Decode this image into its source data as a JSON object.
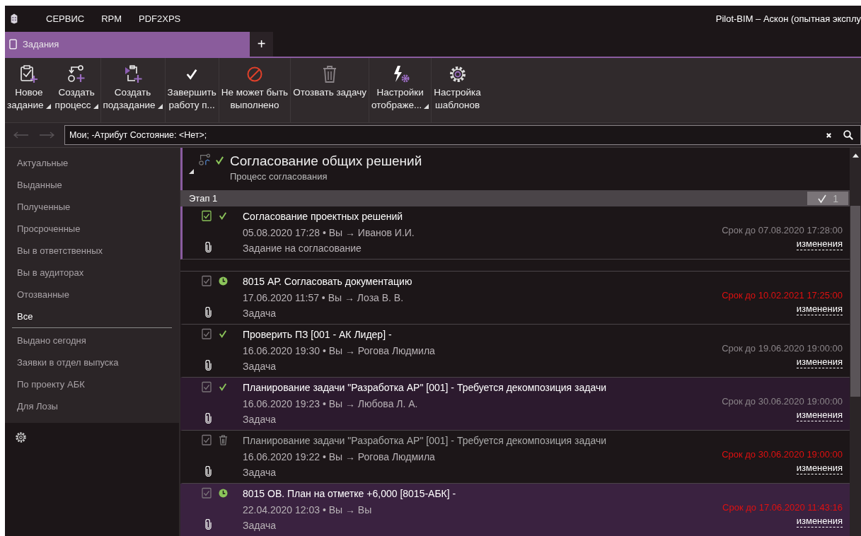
{
  "menu": {
    "items": [
      "СЕРВИС",
      "RPM",
      "PDF2XPS"
    ],
    "title": "Pilot-BIM – Аскон (опытная эксплу"
  },
  "tabs": [
    {
      "label": "Задания",
      "selected": true
    }
  ],
  "new_tab": "+",
  "toolbar": [
    {
      "kind": "taskadd",
      "lines": [
        "Новое",
        "задание"
      ],
      "dropdown": true
    },
    {
      "kind": "processadd",
      "lines": [
        "Создать",
        "процесс"
      ],
      "dropdown": true
    },
    {
      "kind": "subtaskadd",
      "lines": [
        "Создать",
        "подзадание"
      ],
      "dropdown": true
    },
    {
      "kind": "complete",
      "lines": [
        "Завершить",
        "работу п..."
      ],
      "dropdown": false
    },
    {
      "kind": "forbid",
      "lines": [
        "Не может быть",
        "выполнено"
      ],
      "dropdown": false
    },
    {
      "kind": "revoke",
      "lines": [
        "Отозвать задачу"
      ],
      "dropdown": false
    },
    {
      "kind": "display",
      "lines": [
        "Настройки",
        "отображе..."
      ],
      "dropdown": true
    },
    {
      "kind": "templates",
      "lines": [
        "Настройка",
        "шаблонов"
      ],
      "dropdown": false
    }
  ],
  "search": {
    "value": "Мои; -Атрибут Состояние: <Нет>;"
  },
  "sidebar": {
    "groups": [
      [
        {
          "label": "Актуальные",
          "selected": false
        },
        {
          "label": "Выданные",
          "selected": false
        },
        {
          "label": "Полученные",
          "selected": false
        },
        {
          "label": "Просроченные",
          "selected": false
        },
        {
          "label": "Вы в ответственных",
          "selected": false
        },
        {
          "label": "Вы в аудиторах",
          "selected": false
        },
        {
          "label": "Отозванные",
          "selected": false
        },
        {
          "label": "Все",
          "selected": true
        }
      ],
      [
        {
          "label": "Выдано сегодня",
          "selected": false
        },
        {
          "label": "Заявки в отдел выпуска",
          "selected": false
        },
        {
          "label": "По проекту АБК",
          "selected": false
        },
        {
          "label": "Для Лозы",
          "selected": false
        }
      ]
    ]
  },
  "process": {
    "title": "Согласование общих решений",
    "subtitle": "Процесс согласования",
    "expanded": true,
    "done": true,
    "stage": {
      "title": "Этап 1",
      "count": "1"
    },
    "tasks": [
      {
        "title": "Согласование проектных решений",
        "meta": "05.08.2020 17:28 • Вы → Иванов И.И.",
        "kind_label": "Задание на согласование",
        "deadline": "Срок до 07.08.2020 17:28:00",
        "link": "изменения",
        "kind": "done",
        "overdue": false,
        "highlighted": false,
        "selected": true,
        "greyed": false,
        "icon_active": true
      }
    ]
  },
  "tasks": [
    {
      "title": "8015 АР. Согласовать документацию",
      "meta": "17.06.2020 11:57 • Вы → Лоза В. В.",
      "kind_label": "Задача",
      "deadline": "Срок до 10.02.2021 17:25:00",
      "link": "изменения",
      "kind": "waiting",
      "overdue": true,
      "highlighted": false,
      "selected": false,
      "greyed": false,
      "icon_active": false
    },
    {
      "title": "Проверить ПЗ [001 - АК Лидер] -",
      "meta": "16.06.2020 19:30 • Вы → Рогова Людмила",
      "kind_label": "Задача",
      "deadline": "Срок до 19.06.2020 19:00:00",
      "link": "изменения",
      "kind": "done",
      "overdue": false,
      "highlighted": false,
      "selected": false,
      "greyed": false,
      "icon_active": false
    },
    {
      "title": "Планирование задачи \"Разработка АР\" [001] - Требуется декомпозиция задачи",
      "meta": "16.06.2020 19:23 • Вы → Любова Л. А.",
      "kind_label": "Задача",
      "deadline": "Срок до 30.06.2020 19:00:00",
      "link": "изменения",
      "kind": "done",
      "overdue": false,
      "highlighted": true,
      "selected": false,
      "greyed": false,
      "icon_active": false
    },
    {
      "title": "Планирование задачи \"Разработка АР\" [001] - Требуется декомпозиция задачи",
      "meta": "16.06.2020 19:22 • Вы → Рогова Людмила",
      "kind_label": "Задача",
      "deadline": "Срок до 30.06.2020 19:00:00",
      "link": "изменения",
      "kind": "revoked",
      "overdue": true,
      "highlighted": false,
      "selected": false,
      "greyed": true,
      "icon_active": false
    },
    {
      "title": "8015 ОВ. План на отметке +6,000 [8015-АБК] -",
      "meta": "22.04.2020 12:03 • Вы → Вы",
      "kind_label": "Задача",
      "deadline": "Срок до 17.06.2020 11:43:16",
      "link": "изменения",
      "kind": "waiting",
      "overdue": true,
      "highlighted": true,
      "selected": false,
      "greyed": false,
      "icon_active": false
    }
  ]
}
